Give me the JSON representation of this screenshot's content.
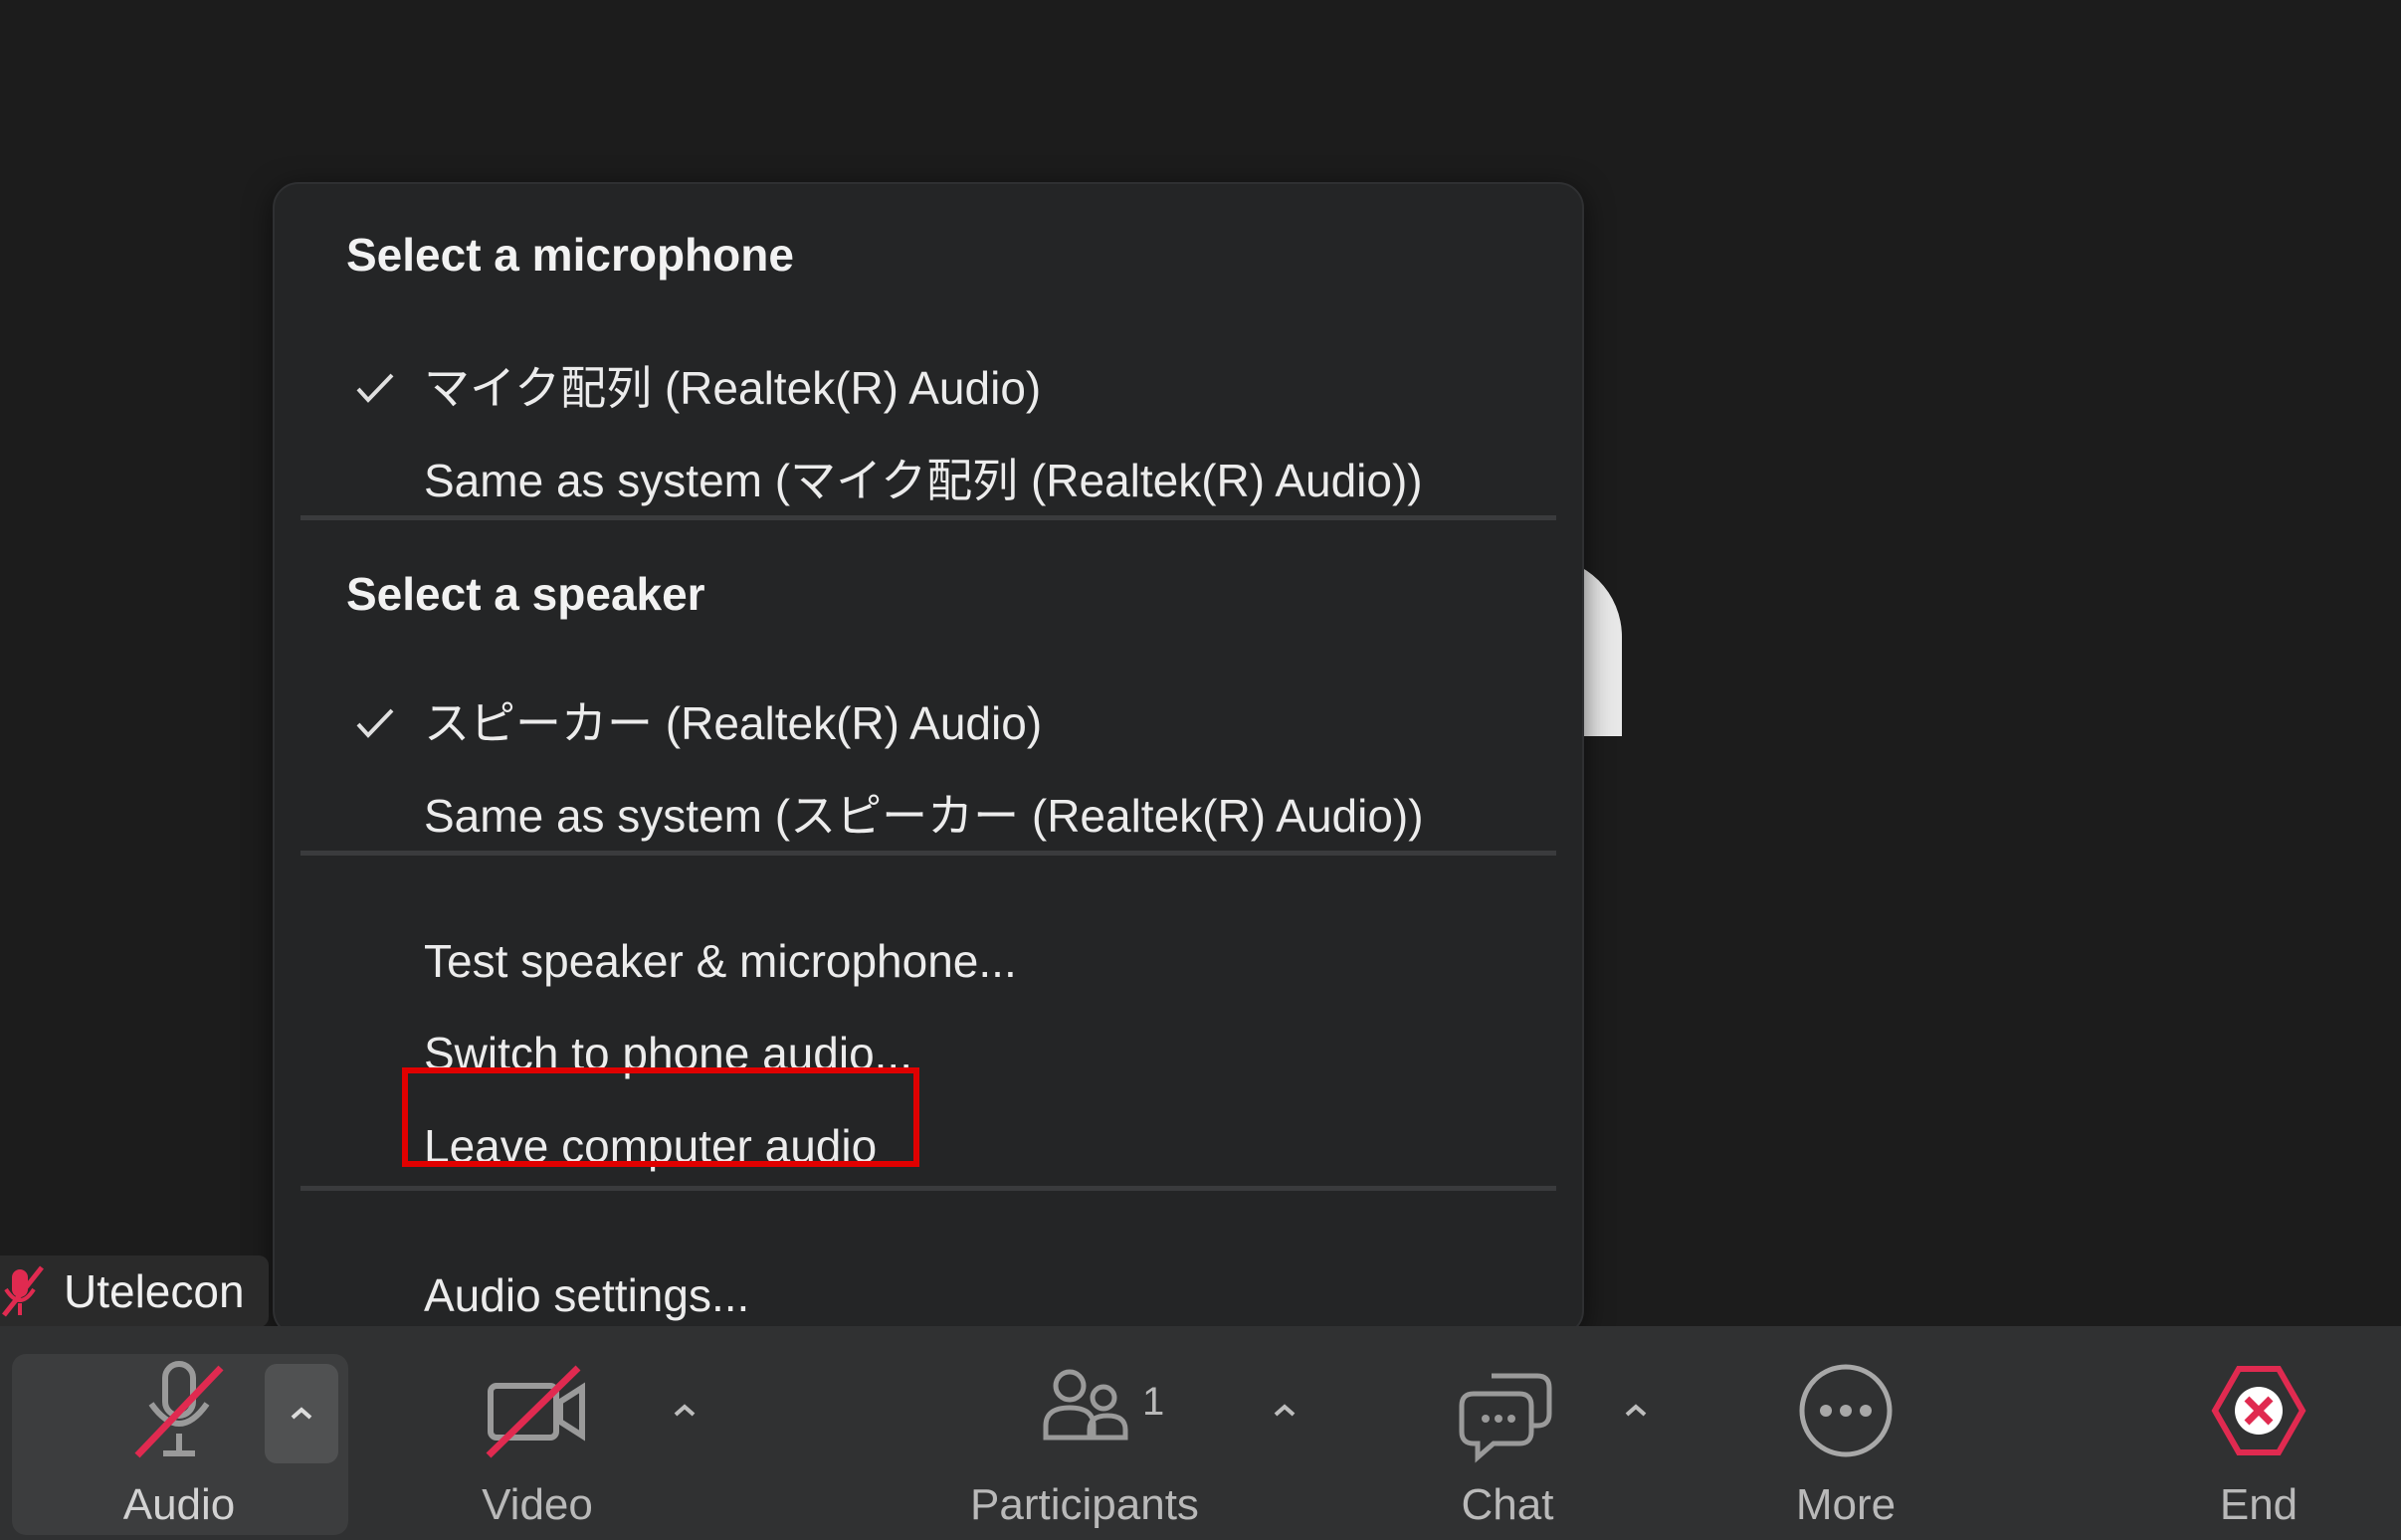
{
  "menu": {
    "microphone": {
      "title": "Select a microphone",
      "items": [
        {
          "label": "マイク配列 (Realtek(R) Audio)",
          "checked": true
        },
        {
          "label": "Same as system (マイク配列 (Realtek(R) Audio))",
          "checked": false
        }
      ]
    },
    "speaker": {
      "title": "Select a speaker",
      "items": [
        {
          "label": "スピーカー (Realtek(R) Audio)",
          "checked": true
        },
        {
          "label": "Same as system (スピーカー (Realtek(R) Audio))",
          "checked": false
        }
      ]
    },
    "actions": [
      {
        "label": "Test speaker & microphone..."
      },
      {
        "label": "Switch to phone audio..."
      },
      {
        "label": "Leave computer audio",
        "highlighted": true
      }
    ],
    "settings": {
      "label": "Audio settings..."
    }
  },
  "participant": {
    "name": "Utelecon",
    "muted": true
  },
  "toolbar": {
    "audio": {
      "label": "Audio",
      "muted": true
    },
    "video": {
      "label": "Video",
      "off": true
    },
    "participants": {
      "label": "Participants",
      "count": "1"
    },
    "chat": {
      "label": "Chat"
    },
    "more": {
      "label": "More"
    },
    "end": {
      "label": "End"
    }
  },
  "colors": {
    "background": "#1c1c1c",
    "menu_bg": "#242526",
    "toolbar_bg": "#303132",
    "muted_red": "#e02a50",
    "highlight_red": "#e00000"
  }
}
